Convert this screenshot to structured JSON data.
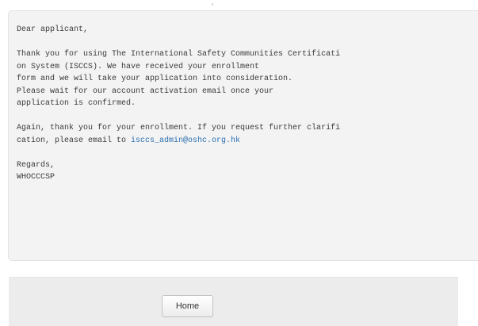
{
  "message": {
    "greeting": "Dear applicant,",
    "paragraph1": [
      "Thank you for using The International Safety Communities Certificati",
      "on System (ISCCS). We have received your enrollment",
      "form and we will take your application into consideration.",
      "Please wait for our account activation email once your",
      "application is confirmed."
    ],
    "paragraph2_line1": "Again, thank you for your enrollment. If you request further clarifi",
    "paragraph2_line2_prefix": "cation, please email to ",
    "email": "isccs_admin@oshc.org.hk",
    "closing": "Regards,",
    "signature": "WHOCCCSP"
  },
  "footer": {
    "home_label": "Home"
  },
  "colors": {
    "panel_background": "#f3f3f3",
    "link": "#2a6fb0",
    "footer_background": "#ececec"
  }
}
